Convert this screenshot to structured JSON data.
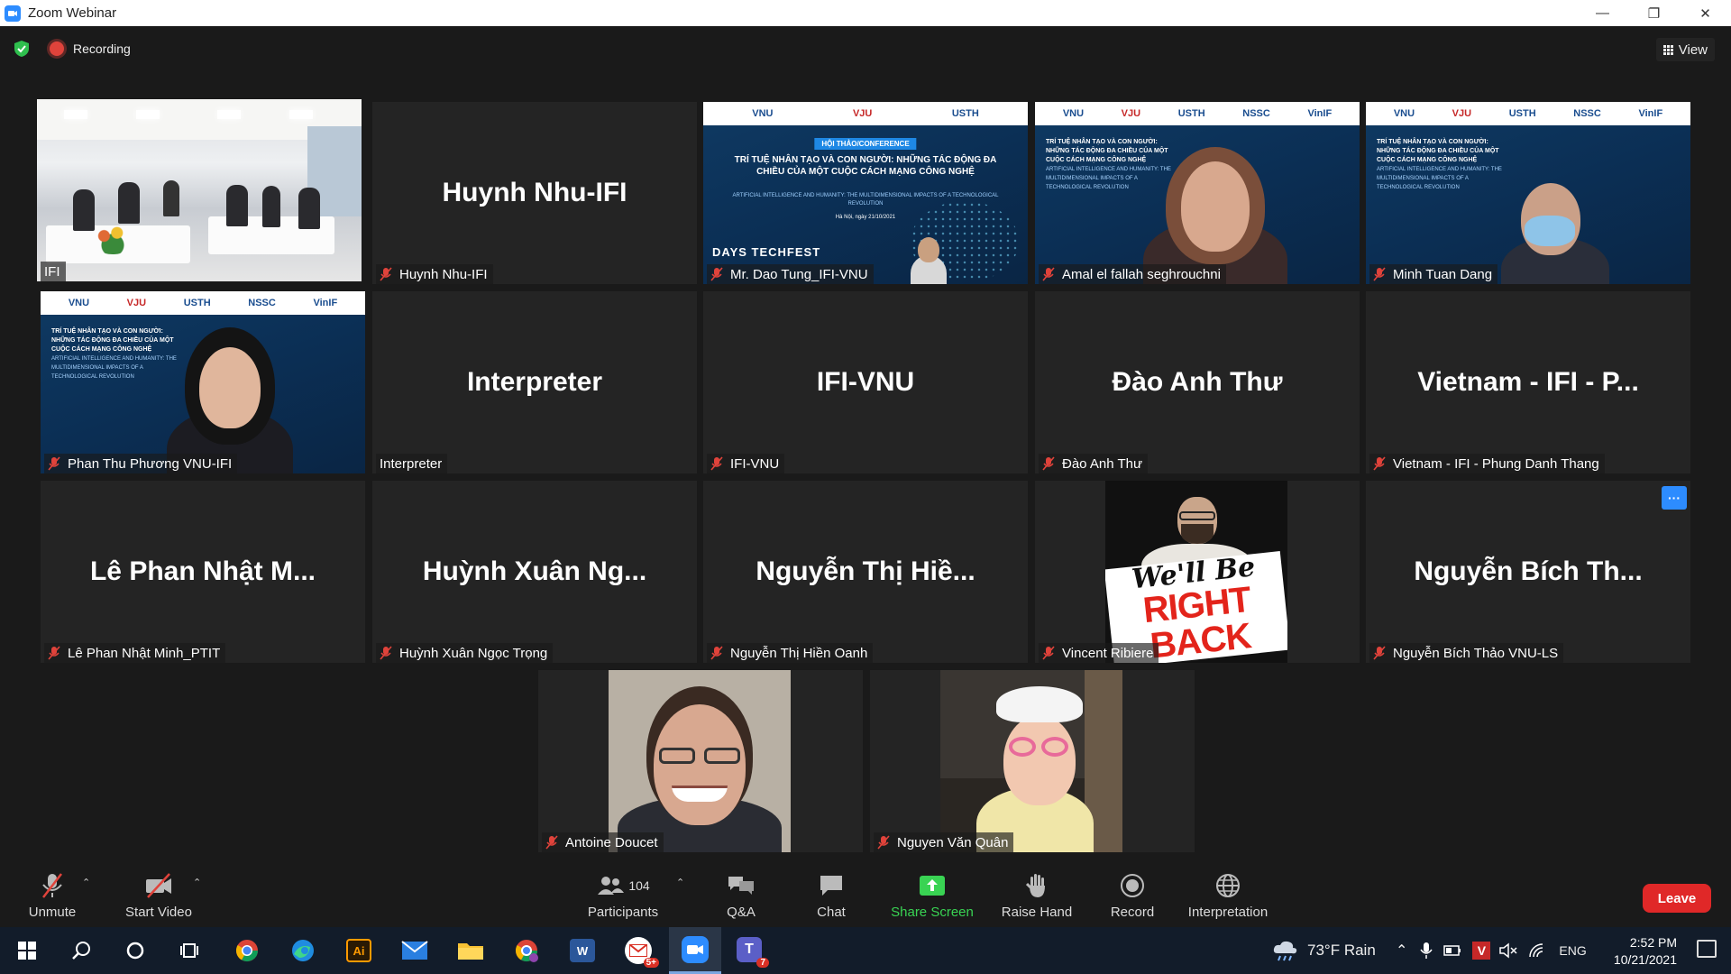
{
  "window": {
    "title": "Zoom Webinar"
  },
  "topbar": {
    "recording_label": "Recording",
    "view_label": "View"
  },
  "tiles": [
    {
      "name_label": "IFI",
      "big_name": "",
      "muted": false
    },
    {
      "name_label": "Huynh Nhu-IFI",
      "big_name": "Huynh Nhu-IFI",
      "muted": true
    },
    {
      "name_label": "Mr. Dao Tung_IFI-VNU",
      "big_name": "",
      "muted": true
    },
    {
      "name_label": "Amal el fallah seghrouchni",
      "big_name": "",
      "muted": true
    },
    {
      "name_label": "Minh Tuan Dang",
      "big_name": "",
      "muted": true
    },
    {
      "name_label": "Phan Thu Phương VNU-IFI",
      "big_name": "",
      "muted": true
    },
    {
      "name_label": "Interpreter",
      "big_name": "Interpreter",
      "muted": false
    },
    {
      "name_label": "IFI-VNU",
      "big_name": "IFI-VNU",
      "muted": true
    },
    {
      "name_label": "Đào Anh Thư",
      "big_name": "Đào Anh Thư",
      "muted": true
    },
    {
      "name_label": "Vietnam - IFI - Phung Danh Thang",
      "big_name": "Vietnam - IFI - P...",
      "muted": true
    },
    {
      "name_label": "Lê Phan Nhật Minh_PTIT",
      "big_name": "Lê Phan Nhật M...",
      "muted": true
    },
    {
      "name_label": "Huỳnh Xuân Ngọc Trọng",
      "big_name": "Huỳnh Xuân Ng...",
      "muted": true
    },
    {
      "name_label": "Nguyễn Thị Hiền Oanh",
      "big_name": "Nguyễn Thị Hiề...",
      "muted": true
    },
    {
      "name_label": "Vincent Ribiere",
      "big_name": "",
      "muted": true
    },
    {
      "name_label": "Nguyễn Bích Thảo VNU-LS",
      "big_name": "Nguyễn Bích Th...",
      "muted": true
    },
    {
      "name_label": "Antoine Doucet",
      "big_name": "",
      "muted": true
    },
    {
      "name_label": "Nguyen Văn Quân",
      "big_name": "",
      "muted": true
    }
  ],
  "slide": {
    "logos": [
      "VNU",
      "USTH",
      "VJU",
      "NSSC",
      "VinIF"
    ],
    "tag": "HỘI THẢO/CONFERENCE",
    "heading": "TRÍ TUỆ NHÂN TẠO VÀ CON NGƯỜI: NHỮNG TÁC ĐỘNG ĐA CHIỀU CỦA MỘT CUỘC CÁCH MẠNG CÔNG NGHỆ",
    "subheading": "ARTIFICIAL INTELLIGENCE AND HUMANITY: THE MULTIDIMENSIONAL IMPACTS OF A TECHNOLOGICAL REVOLUTION",
    "date": "Hà Nội, ngày 21/10/2021",
    "brand": "DAYS TECHFEST"
  },
  "brb": {
    "line1": "We'll Be",
    "line2": "RIGHT",
    "line3": "BACK"
  },
  "more_button": "···",
  "toolbar": {
    "unmute": "Unmute",
    "start_video": "Start Video",
    "participants_count": "104",
    "participants": "Participants",
    "qa": "Q&A",
    "chat": "Chat",
    "share_screen": "Share Screen",
    "raise_hand": "Raise Hand",
    "record": "Record",
    "interpretation": "Interpretation",
    "leave": "Leave"
  },
  "taskbar": {
    "weather": "73°F  Rain",
    "lang": "ENG",
    "time": "2:52 PM",
    "date": "10/21/2021",
    "ai_label": "Ai",
    "word_label": "W",
    "mail_badge": "5+",
    "teams_badge": "7"
  },
  "colors": {
    "accent_blue": "#2d8cff",
    "active_speaker": "#c6e65a",
    "leave_red": "#e02828",
    "share_green": "#39d353",
    "muted_red": "#e0433b"
  }
}
